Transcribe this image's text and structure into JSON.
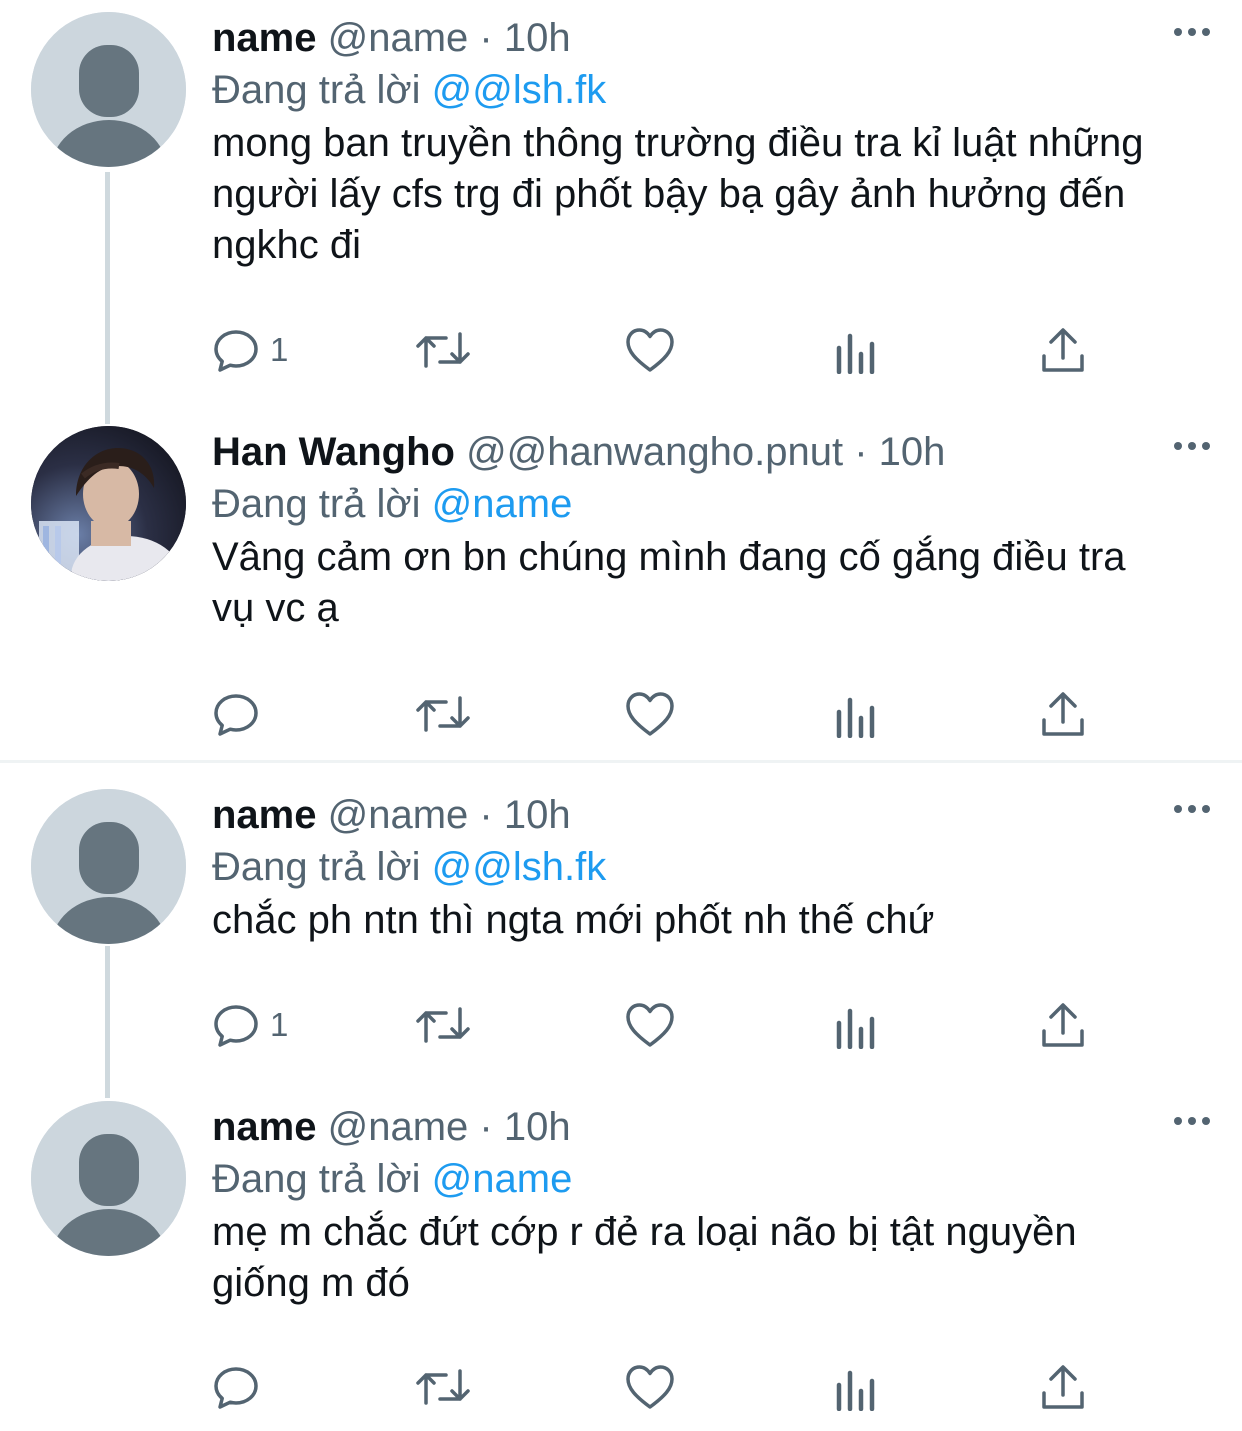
{
  "tweets": [
    {
      "name": "name",
      "meta": "@name · 10h",
      "reply_prefix": "Đang trả lời",
      "reply_to": "@@lsh.fk",
      "text": "mong ban truyền thông trường điều tra kỉ luật những người lấy cfs trg đi phốt bậy bạ gây ảnh hưởng đến ngkhc đi",
      "reply_count": "1",
      "avatar": "default-avatar-icon"
    },
    {
      "name": "Han Wangho",
      "meta": "@@hanwangho.pnut · 10h",
      "reply_prefix": "Đang trả lời",
      "reply_to": "@name",
      "text": "Vâng cảm ơn bn chúng mình đang cố gắng điều tra vụ vc ạ",
      "reply_count": "",
      "avatar": "profile-photo"
    },
    {
      "name": "name",
      "meta": "@name · 10h",
      "reply_prefix": "Đang trả lời",
      "reply_to": "@@lsh.fk",
      "text": "chắc ph ntn thì ngta mới phốt nh thế chứ",
      "reply_count": "1",
      "avatar": "default-avatar-icon"
    },
    {
      "name": "name",
      "meta": "@name · 10h",
      "reply_prefix": "Đang trả lời",
      "reply_to": "@name",
      "text": "mẹ m chắc đứt cớp r đẻ ra loại não bị tật nguyền giống m đó",
      "reply_count": "",
      "avatar": "default-avatar-icon"
    }
  ],
  "icons": {
    "reply": "reply-icon",
    "retweet": "retweet-icon",
    "like": "heart-icon",
    "views": "views-icon",
    "share": "share-icon",
    "more": "more-icon"
  },
  "colors": {
    "link": "#1d9bf0",
    "secondary_text": "#536471",
    "thread_line": "#cfd9de",
    "avatar_placeholder": "#ccd6dd"
  }
}
